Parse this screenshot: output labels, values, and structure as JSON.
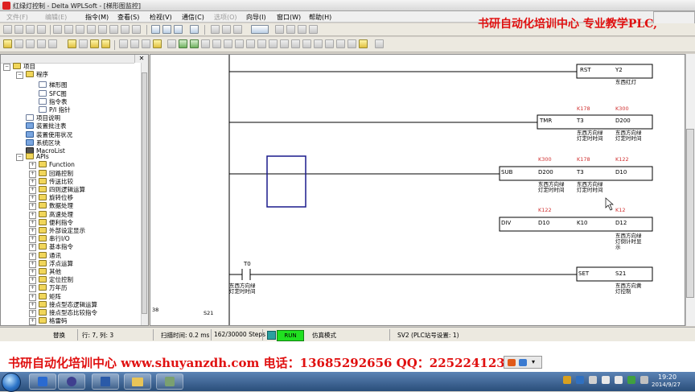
{
  "window": {
    "title": "红绿灯控制 - Delta WPLSoft - [梯形图监控]"
  },
  "menubar": {
    "items": [
      {
        "label": "文件(F)",
        "enabled": false
      },
      {
        "label": "编辑(E)",
        "enabled": false
      },
      {
        "label": "指令(M)",
        "enabled": true
      },
      {
        "label": "查看(S)",
        "enabled": true
      },
      {
        "label": "检视(V)",
        "enabled": true
      },
      {
        "label": "通信(C)",
        "enabled": true
      },
      {
        "label": "选项(O)",
        "enabled": false
      },
      {
        "label": "向导(I)",
        "enabled": true
      },
      {
        "label": "窗口(W)",
        "enabled": true
      },
      {
        "label": "帮助(H)",
        "enabled": true
      }
    ]
  },
  "watermark": {
    "top": "书研自动化培训中心 专业教学PLC,",
    "bottom": "书研自动化培训中心 www.shuyanzdh.com  电话：13685292656 QQ：2252241236"
  },
  "tree": {
    "nodes": [
      {
        "label": "项目",
        "level": 0,
        "icon": "folder"
      },
      {
        "label": "程序",
        "level": 1,
        "icon": "folder"
      },
      {
        "label": "梯形图",
        "level": 2,
        "icon": "doc"
      },
      {
        "label": "SFC图",
        "level": 2,
        "icon": "doc"
      },
      {
        "label": "指令表",
        "level": 2,
        "icon": "doc"
      },
      {
        "label": "P/I 指针",
        "level": 2,
        "icon": "doc"
      },
      {
        "label": "项目说明",
        "level": 1,
        "icon": "doc"
      },
      {
        "label": "装置批注表",
        "level": 1,
        "icon": "blue"
      },
      {
        "label": "装置使用状况",
        "level": 1,
        "icon": "blue"
      },
      {
        "label": "系统区块",
        "level": 1,
        "icon": "blue"
      },
      {
        "label": "MacroList",
        "level": 1,
        "icon": "dark"
      },
      {
        "label": "APIs",
        "level": 1,
        "icon": "folder"
      },
      {
        "label": "Function",
        "level": 2,
        "icon": "folder"
      },
      {
        "label": "回路控制",
        "level": 2,
        "icon": "folder"
      },
      {
        "label": "传送比较",
        "level": 2,
        "icon": "folder"
      },
      {
        "label": "四则逻辑运算",
        "level": 2,
        "icon": "folder"
      },
      {
        "label": "旋转位移",
        "level": 2,
        "icon": "folder"
      },
      {
        "label": "数据处理",
        "level": 2,
        "icon": "folder"
      },
      {
        "label": "高速处理",
        "level": 2,
        "icon": "folder"
      },
      {
        "label": "便利指令",
        "level": 2,
        "icon": "folder"
      },
      {
        "label": "外部设定显示",
        "level": 2,
        "icon": "folder"
      },
      {
        "label": "串行I/O",
        "level": 2,
        "icon": "folder"
      },
      {
        "label": "基本指令",
        "level": 2,
        "icon": "folder"
      },
      {
        "label": "通讯",
        "level": 2,
        "icon": "folder"
      },
      {
        "label": "浮点运算",
        "level": 2,
        "icon": "folder"
      },
      {
        "label": "其他",
        "level": 2,
        "icon": "folder"
      },
      {
        "label": "定位控制",
        "level": 2,
        "icon": "folder"
      },
      {
        "label": "万年历",
        "level": 2,
        "icon": "folder"
      },
      {
        "label": "矩阵",
        "level": 2,
        "icon": "folder"
      },
      {
        "label": "接点型态逻辑运算",
        "level": 2,
        "icon": "folder"
      },
      {
        "label": "接点型态比较指令",
        "level": 2,
        "icon": "folder"
      },
      {
        "label": "格雷码",
        "level": 2,
        "icon": "folder"
      }
    ]
  },
  "ladder": {
    "rst": {
      "op": "RST",
      "arg": "Y2",
      "comment": "东西红灯"
    },
    "tmr": {
      "op": "TMR",
      "a1": "T3",
      "a2": "D200",
      "v1": "K178",
      "v2": "K300",
      "c1a": "东西方向绿",
      "c1b": "灯定时时间",
      "c2a": "东西方向绿",
      "c2b": "灯定时时间"
    },
    "sub": {
      "op": "SUB",
      "a1": "D200",
      "a2": "T3",
      "a3": "D10",
      "v1": "K300",
      "v2": "K178",
      "v3": "K122",
      "c1a": "东西方向绿",
      "c1b": "灯定时时间",
      "c2a": "东西方向绿",
      "c2b": "灯定时时间"
    },
    "div": {
      "op": "DIV",
      "a1": "D10",
      "a2": "K10",
      "a3": "D12",
      "v1": "K122",
      "v3": "K12",
      "c3a": "东西方向绿",
      "c3b": "灯倒计时显",
      "c3c": "示"
    },
    "set": {
      "contact": "T0",
      "ca": "东西方向绿",
      "cb": "灯定时时间",
      "op": "SET",
      "arg": "S21",
      "c1a": "东西方向黄",
      "c1b": "灯控制"
    },
    "row_number": "38",
    "next_step": "S21"
  },
  "status": {
    "mode": "替换",
    "position": "行: 7, 列: 3",
    "scan_time": "扫描时间: 0.2 ms",
    "steps": "162/30000 Steps",
    "run": "RUN",
    "sim": "仿真模式",
    "station": "SV2 (PLC站号设置: 1)"
  },
  "clock": {
    "time": "19:20",
    "date": "2014/9/27"
  },
  "colors": {
    "run_badge": "#20e020",
    "watermark": "#e01010",
    "selection": "#1a1a8c",
    "comment_value": "#d03030"
  }
}
